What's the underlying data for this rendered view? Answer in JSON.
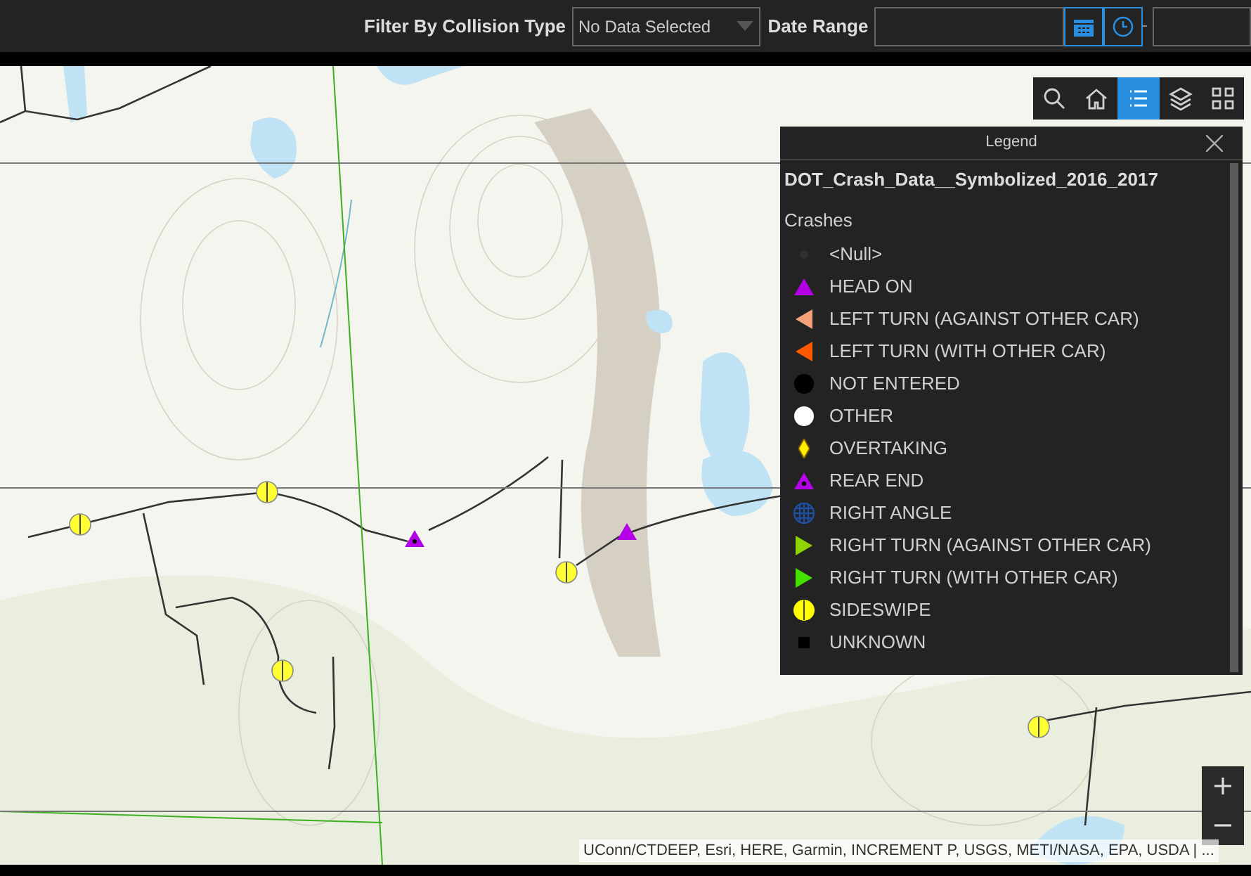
{
  "filter_bar": {
    "collision_label": "Filter By Collision Type",
    "collision_select": {
      "value": "No Data Selected"
    },
    "date_label": "Date Range",
    "date_buttons": [
      {
        "kind": "calendar",
        "selected": true
      },
      {
        "kind": "clock",
        "selected": true
      }
    ]
  },
  "map_toolbar": [
    {
      "kind": "search",
      "selected": false
    },
    {
      "kind": "home",
      "selected": false
    },
    {
      "kind": "legend",
      "selected": true
    },
    {
      "kind": "layers",
      "selected": false
    },
    {
      "kind": "basemap",
      "selected": false
    }
  ],
  "legend": {
    "title": "Legend",
    "layer": "DOT_Crash_Data__Symbolized_2016_2017",
    "group": "Crashes",
    "items": [
      {
        "label": "<Null>",
        "kind": "dot",
        "color": "#303030"
      },
      {
        "label": "HEAD ON",
        "kind": "triangle-up",
        "color": "#b400e6"
      },
      {
        "label": "LEFT TURN (AGAINST OTHER CAR)",
        "kind": "triangle-left",
        "color": "#f5a27a"
      },
      {
        "label": "LEFT TURN (WITH OTHER CAR)",
        "kind": "triangle-left",
        "color": "#ff5a00"
      },
      {
        "label": "NOT ENTERED",
        "kind": "circle",
        "color": "#000000"
      },
      {
        "label": "OTHER",
        "kind": "circle",
        "color": "#ffffff"
      },
      {
        "label": "OVERTAKING",
        "kind": "diamond",
        "color": "#ffee00"
      },
      {
        "label": "REAR END",
        "kind": "triangle-dot",
        "color": "#b400e6"
      },
      {
        "label": "RIGHT ANGLE",
        "kind": "globe",
        "color": "#1f4e9e"
      },
      {
        "label": "RIGHT TURN (AGAINST OTHER CAR)",
        "kind": "triangle-right",
        "color": "#8ed400"
      },
      {
        "label": "RIGHT TURN (WITH OTHER CAR)",
        "kind": "triangle-right",
        "color": "#44e000"
      },
      {
        "label": "SIDESWIPE",
        "kind": "split-circle",
        "color": "#ffff00"
      },
      {
        "label": "UNKNOWN",
        "kind": "square",
        "color": "#000000"
      }
    ]
  },
  "zoom_controls": [
    {
      "kind": "plus"
    },
    {
      "kind": "minus"
    }
  ],
  "attribution": "UConn/CTDEEP, Esri, HERE, Garmin, INCREMENT P, USGS, METI/NASA, EPA, USDA | ..."
}
